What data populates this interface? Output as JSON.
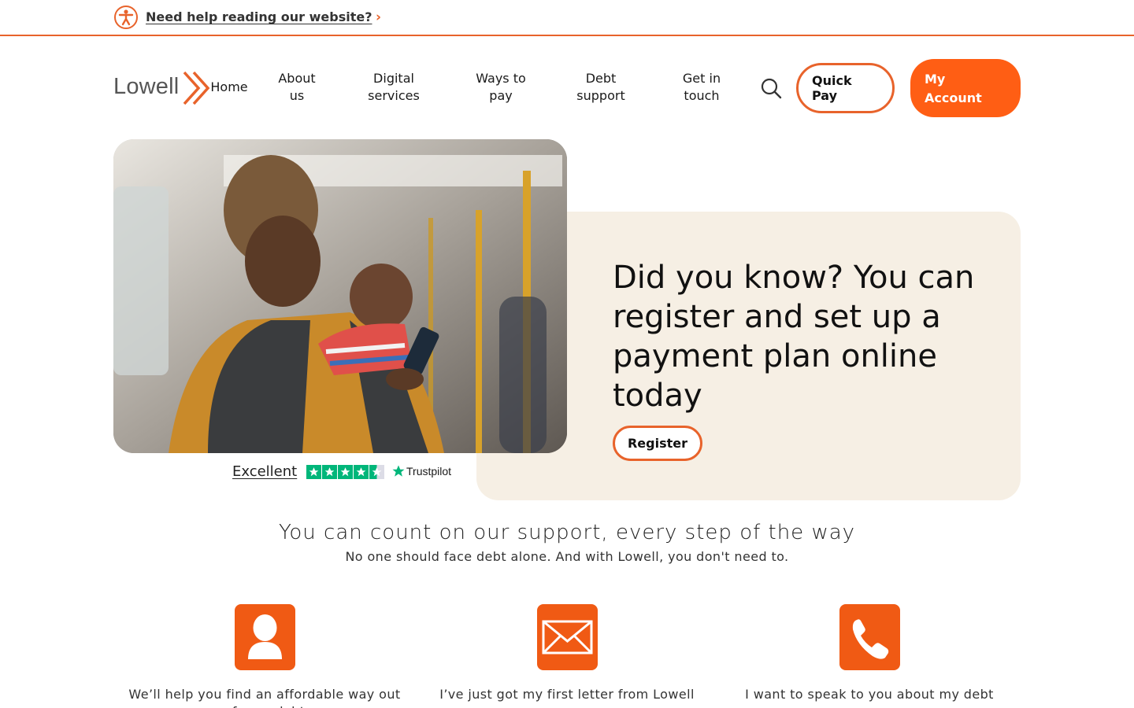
{
  "a11y_bar": {
    "link_text": "Need help reading our website?"
  },
  "header": {
    "logo_text": "Lowell",
    "nav": [
      {
        "line1": "Home",
        "line2": ""
      },
      {
        "line1": "About",
        "line2": "us"
      },
      {
        "line1": "Digital",
        "line2": "services"
      },
      {
        "line1": "Ways to",
        "line2": "pay"
      },
      {
        "line1": "Debt",
        "line2": "support"
      },
      {
        "line1": "Get in",
        "line2": "touch"
      }
    ],
    "quick_pay": {
      "line1": "Quick",
      "line2": "Pay"
    },
    "my_account": {
      "line1": "My",
      "line2": "Account"
    }
  },
  "hero": {
    "promo_title": "Did you know? You can register and set up a payment plan online today",
    "register_label": "Register"
  },
  "trustpilot": {
    "rating_text": "Excellent",
    "brand": "Trustpilot",
    "stars": 4.5
  },
  "support": {
    "title": "You can count on our support, every step of the way",
    "subtitle": "No one should face debt alone. And with Lowell, you don't need to.",
    "features": [
      {
        "label": "We’ll help you find an affordable way out of your debt",
        "icon": "user-icon"
      },
      {
        "label": "I’ve just got my first letter from Lowell",
        "icon": "envelope-icon"
      },
      {
        "label": "I want to speak to you about my debt",
        "icon": "phone-icon"
      }
    ]
  },
  "colors": {
    "brand_orange": "#ff5e14",
    "outline_orange": "#e8632b",
    "promo_bg": "#f6efe4",
    "trustpilot_green": "#00b67a"
  }
}
